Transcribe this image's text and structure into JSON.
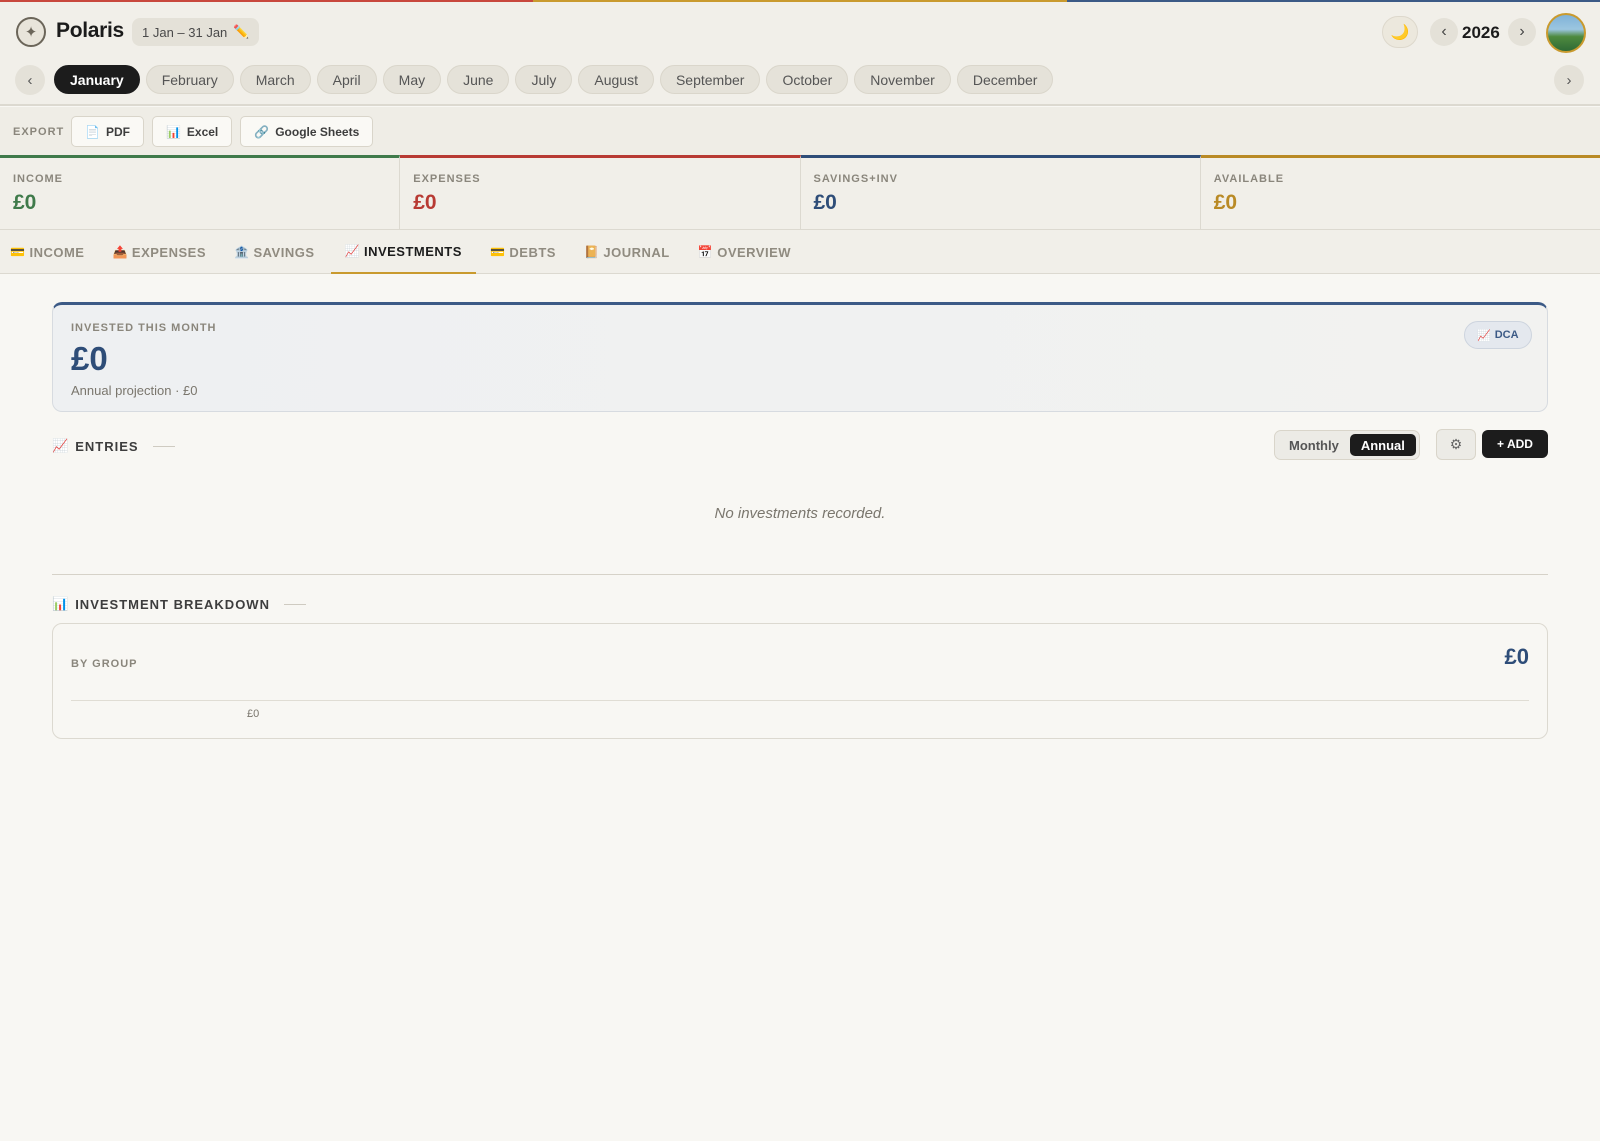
{
  "colors": {
    "accent_red": "#c8473d",
    "accent_gold": "#c99a2e",
    "accent_blue": "#3c5a86",
    "accent_green": "#3f7a4a"
  },
  "header": {
    "brand": "Polaris",
    "logo_icon": "compass-icon",
    "date_range": "1 Jan – 31 Jan",
    "edit_icon": "✏️",
    "theme_icon": "🌙",
    "year": "2026",
    "prev_glyph": "‹",
    "next_glyph": "›"
  },
  "months": [
    "January",
    "February",
    "March",
    "April",
    "May",
    "June",
    "July",
    "August",
    "September",
    "October",
    "November",
    "December"
  ],
  "active_month": "January",
  "export": {
    "label": "EXPORT",
    "buttons": [
      {
        "icon": "📄",
        "label": "PDF"
      },
      {
        "icon": "📊",
        "label": "Excel"
      },
      {
        "icon": "🔗",
        "label": "Google Sheets"
      }
    ]
  },
  "summary": [
    {
      "label": "INCOME",
      "value": "£0",
      "color": "#3f7a4a"
    },
    {
      "label": "EXPENSES",
      "value": "£0",
      "color": "#b83a33"
    },
    {
      "label": "SAVINGS+INV",
      "value": "£0",
      "color": "#2e4d78"
    },
    {
      "label": "AVAILABLE",
      "value": "£0",
      "color": "#b98a25"
    }
  ],
  "tabs": [
    {
      "icon": "💳",
      "label": "INCOME"
    },
    {
      "icon": "📤",
      "label": "EXPENSES"
    },
    {
      "icon": "🏦",
      "label": "SAVINGS"
    },
    {
      "icon": "📈",
      "label": "INVESTMENTS"
    },
    {
      "icon": "💳",
      "label": "DEBTS"
    },
    {
      "icon": "📔",
      "label": "JOURNAL"
    },
    {
      "icon": "📅",
      "label": "OVERVIEW"
    }
  ],
  "active_tab": "INVESTMENTS",
  "invested": {
    "label": "INVESTED THIS MONTH",
    "value": "£0",
    "projection": "Annual projection · £0",
    "dca_icon": "📈",
    "dca_label": "DCA"
  },
  "entries": {
    "icon": "📈",
    "title": "ENTRIES",
    "toggle": [
      "Monthly",
      "Annual"
    ],
    "toggle_active": "Annual",
    "gear_icon": "⚙",
    "add_label": "+ ADD",
    "empty_message": "No investments recorded."
  },
  "breakdown": {
    "icon": "📊",
    "title": "INVESTMENT BREAKDOWN",
    "group_label": "BY GROUP",
    "total": "£0",
    "tick": "£0"
  }
}
